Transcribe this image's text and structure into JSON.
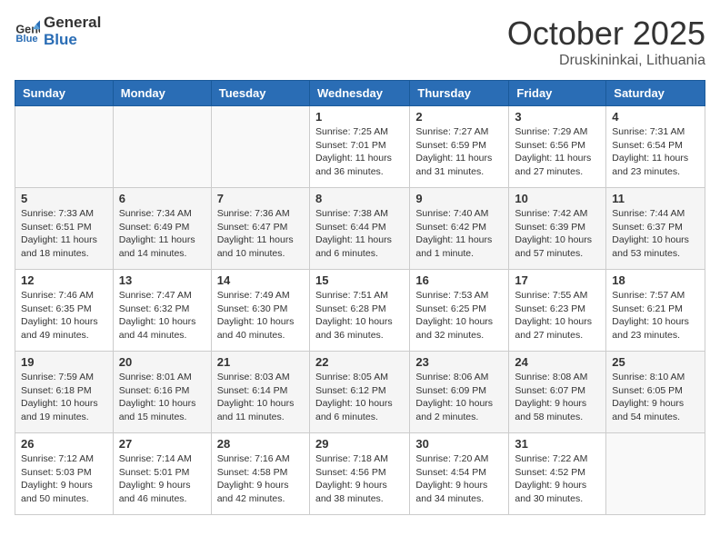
{
  "header": {
    "logo_general": "General",
    "logo_blue": "Blue",
    "month": "October 2025",
    "location": "Druskininkai, Lithuania"
  },
  "weekdays": [
    "Sunday",
    "Monday",
    "Tuesday",
    "Wednesday",
    "Thursday",
    "Friday",
    "Saturday"
  ],
  "weeks": [
    [
      {
        "day": "",
        "info": ""
      },
      {
        "day": "",
        "info": ""
      },
      {
        "day": "",
        "info": ""
      },
      {
        "day": "1",
        "info": "Sunrise: 7:25 AM\nSunset: 7:01 PM\nDaylight: 11 hours\nand 36 minutes."
      },
      {
        "day": "2",
        "info": "Sunrise: 7:27 AM\nSunset: 6:59 PM\nDaylight: 11 hours\nand 31 minutes."
      },
      {
        "day": "3",
        "info": "Sunrise: 7:29 AM\nSunset: 6:56 PM\nDaylight: 11 hours\nand 27 minutes."
      },
      {
        "day": "4",
        "info": "Sunrise: 7:31 AM\nSunset: 6:54 PM\nDaylight: 11 hours\nand 23 minutes."
      }
    ],
    [
      {
        "day": "5",
        "info": "Sunrise: 7:33 AM\nSunset: 6:51 PM\nDaylight: 11 hours\nand 18 minutes."
      },
      {
        "day": "6",
        "info": "Sunrise: 7:34 AM\nSunset: 6:49 PM\nDaylight: 11 hours\nand 14 minutes."
      },
      {
        "day": "7",
        "info": "Sunrise: 7:36 AM\nSunset: 6:47 PM\nDaylight: 11 hours\nand 10 minutes."
      },
      {
        "day": "8",
        "info": "Sunrise: 7:38 AM\nSunset: 6:44 PM\nDaylight: 11 hours\nand 6 minutes."
      },
      {
        "day": "9",
        "info": "Sunrise: 7:40 AM\nSunset: 6:42 PM\nDaylight: 11 hours\nand 1 minute."
      },
      {
        "day": "10",
        "info": "Sunrise: 7:42 AM\nSunset: 6:39 PM\nDaylight: 10 hours\nand 57 minutes."
      },
      {
        "day": "11",
        "info": "Sunrise: 7:44 AM\nSunset: 6:37 PM\nDaylight: 10 hours\nand 53 minutes."
      }
    ],
    [
      {
        "day": "12",
        "info": "Sunrise: 7:46 AM\nSunset: 6:35 PM\nDaylight: 10 hours\nand 49 minutes."
      },
      {
        "day": "13",
        "info": "Sunrise: 7:47 AM\nSunset: 6:32 PM\nDaylight: 10 hours\nand 44 minutes."
      },
      {
        "day": "14",
        "info": "Sunrise: 7:49 AM\nSunset: 6:30 PM\nDaylight: 10 hours\nand 40 minutes."
      },
      {
        "day": "15",
        "info": "Sunrise: 7:51 AM\nSunset: 6:28 PM\nDaylight: 10 hours\nand 36 minutes."
      },
      {
        "day": "16",
        "info": "Sunrise: 7:53 AM\nSunset: 6:25 PM\nDaylight: 10 hours\nand 32 minutes."
      },
      {
        "day": "17",
        "info": "Sunrise: 7:55 AM\nSunset: 6:23 PM\nDaylight: 10 hours\nand 27 minutes."
      },
      {
        "day": "18",
        "info": "Sunrise: 7:57 AM\nSunset: 6:21 PM\nDaylight: 10 hours\nand 23 minutes."
      }
    ],
    [
      {
        "day": "19",
        "info": "Sunrise: 7:59 AM\nSunset: 6:18 PM\nDaylight: 10 hours\nand 19 minutes."
      },
      {
        "day": "20",
        "info": "Sunrise: 8:01 AM\nSunset: 6:16 PM\nDaylight: 10 hours\nand 15 minutes."
      },
      {
        "day": "21",
        "info": "Sunrise: 8:03 AM\nSunset: 6:14 PM\nDaylight: 10 hours\nand 11 minutes."
      },
      {
        "day": "22",
        "info": "Sunrise: 8:05 AM\nSunset: 6:12 PM\nDaylight: 10 hours\nand 6 minutes."
      },
      {
        "day": "23",
        "info": "Sunrise: 8:06 AM\nSunset: 6:09 PM\nDaylight: 10 hours\nand 2 minutes."
      },
      {
        "day": "24",
        "info": "Sunrise: 8:08 AM\nSunset: 6:07 PM\nDaylight: 9 hours\nand 58 minutes."
      },
      {
        "day": "25",
        "info": "Sunrise: 8:10 AM\nSunset: 6:05 PM\nDaylight: 9 hours\nand 54 minutes."
      }
    ],
    [
      {
        "day": "26",
        "info": "Sunrise: 7:12 AM\nSunset: 5:03 PM\nDaylight: 9 hours\nand 50 minutes."
      },
      {
        "day": "27",
        "info": "Sunrise: 7:14 AM\nSunset: 5:01 PM\nDaylight: 9 hours\nand 46 minutes."
      },
      {
        "day": "28",
        "info": "Sunrise: 7:16 AM\nSunset: 4:58 PM\nDaylight: 9 hours\nand 42 minutes."
      },
      {
        "day": "29",
        "info": "Sunrise: 7:18 AM\nSunset: 4:56 PM\nDaylight: 9 hours\nand 38 minutes."
      },
      {
        "day": "30",
        "info": "Sunrise: 7:20 AM\nSunset: 4:54 PM\nDaylight: 9 hours\nand 34 minutes."
      },
      {
        "day": "31",
        "info": "Sunrise: 7:22 AM\nSunset: 4:52 PM\nDaylight: 9 hours\nand 30 minutes."
      },
      {
        "day": "",
        "info": ""
      }
    ]
  ]
}
